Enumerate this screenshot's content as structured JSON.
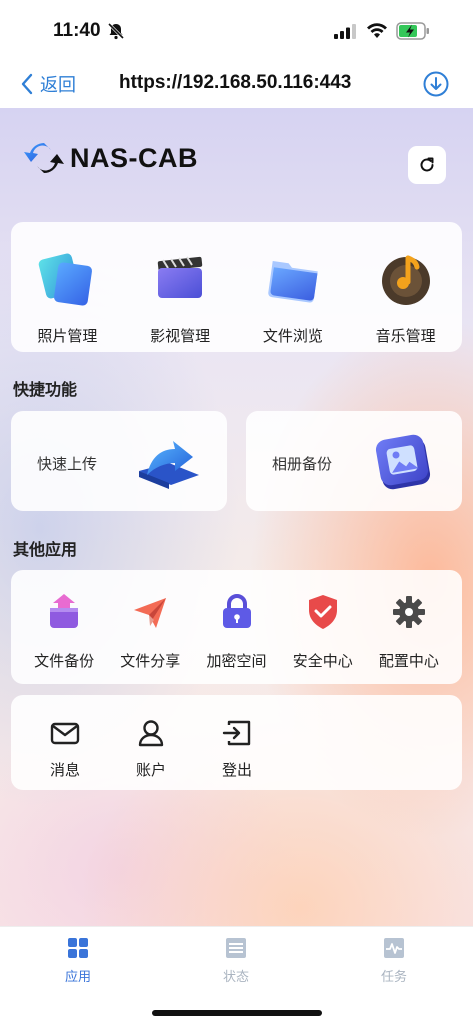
{
  "status_bar": {
    "time": "11:40",
    "icons": [
      "bell-off-icon",
      "signal-icon",
      "wifi-icon",
      "battery-charging-icon"
    ]
  },
  "browser": {
    "back_label": "返回",
    "url": "https://192.168.50.116:443",
    "accent": "#2f7fd6"
  },
  "header": {
    "logo_text": "NAS-CAB"
  },
  "media": [
    {
      "label": "照片管理",
      "icon": "photos-icon"
    },
    {
      "label": "影视管理",
      "icon": "video-icon"
    },
    {
      "label": "文件浏览",
      "icon": "folder-icon"
    },
    {
      "label": "音乐管理",
      "icon": "music-icon"
    }
  ],
  "quick": {
    "title": "快捷功能",
    "items": [
      {
        "label": "快速上传",
        "icon": "upload-arrow-icon"
      },
      {
        "label": "相册备份",
        "icon": "album-icon"
      }
    ]
  },
  "other": {
    "title": "其他应用",
    "items": [
      {
        "label": "文件备份",
        "icon": "file-backup-icon"
      },
      {
        "label": "文件分享",
        "icon": "paper-plane-icon"
      },
      {
        "label": "加密空间",
        "icon": "lock-icon"
      },
      {
        "label": "安全中心",
        "icon": "shield-icon"
      },
      {
        "label": "配置中心",
        "icon": "gear-icon"
      }
    ]
  },
  "misc": [
    {
      "label": "消息",
      "icon": "mail-icon"
    },
    {
      "label": "账户",
      "icon": "user-icon"
    },
    {
      "label": "登出",
      "icon": "logout-icon"
    }
  ],
  "tabs": [
    {
      "label": "应用",
      "icon": "apps-grid-icon",
      "active": true,
      "color": "#3a74d9"
    },
    {
      "label": "状态",
      "icon": "status-icon",
      "active": false,
      "color": "#b7c3d2"
    },
    {
      "label": "任务",
      "icon": "tasks-icon",
      "active": false,
      "color": "#b7c3d2"
    }
  ]
}
